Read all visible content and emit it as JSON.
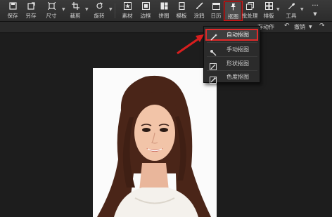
{
  "toolbar": {
    "save": "保存",
    "save_as": "另存",
    "size": "尺寸",
    "crop": "裁剪",
    "rotate": "旋转",
    "material": "素材",
    "border": "边框",
    "puzzle": "拼图",
    "template": "模板",
    "scribble": "涂鸦",
    "calendar": "日历",
    "cutout": "抠图",
    "batch": "批处理",
    "layout": "排版",
    "tools": "工具"
  },
  "subbar": {
    "save_action": "存动作",
    "undo": "撤销"
  },
  "cutout_menu": {
    "items": [
      {
        "label": "自动抠图",
        "icon": "wand-icon"
      },
      {
        "label": "手动抠图",
        "icon": "manual-brush-icon"
      },
      {
        "label": "形状抠图",
        "icon": "shape-icon"
      },
      {
        "label": "色度抠图",
        "icon": "color-picker-icon"
      }
    ]
  },
  "colors": {
    "highlight": "#e02a2a",
    "toolbar_bg": "#2c2c2c",
    "canvas_bg": "#1d1d1d"
  }
}
